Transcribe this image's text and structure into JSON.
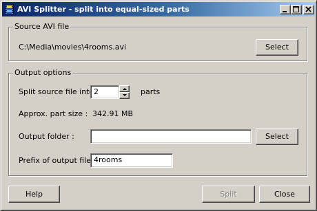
{
  "window": {
    "title": "AVI Splitter - split into equal-sized parts",
    "icon": "app-film-icon",
    "controls": [
      "minimize-icon",
      "maximize-icon",
      "close-icon"
    ]
  },
  "source": {
    "legend": "Source AVI file",
    "path": "C:\\Media\\movies\\4rooms.avi",
    "select_label": "Select"
  },
  "output": {
    "legend": "Output options",
    "split_label": "Split source file into",
    "split_value": "2",
    "parts_label": "parts",
    "part_size_label": "Approx. part size :",
    "part_size_value": "342.91 MB",
    "folder_label": "Output folder :",
    "folder_value": "",
    "folder_select_label": "Select",
    "prefix_label": "Prefix of output files :",
    "prefix_value": "4rooms"
  },
  "buttons": {
    "help": "Help",
    "split": "Split",
    "close": "Close"
  },
  "colors": {
    "titlebar_start": "#0a246a",
    "titlebar_end": "#a6caf0",
    "face": "#d4d0c8"
  }
}
